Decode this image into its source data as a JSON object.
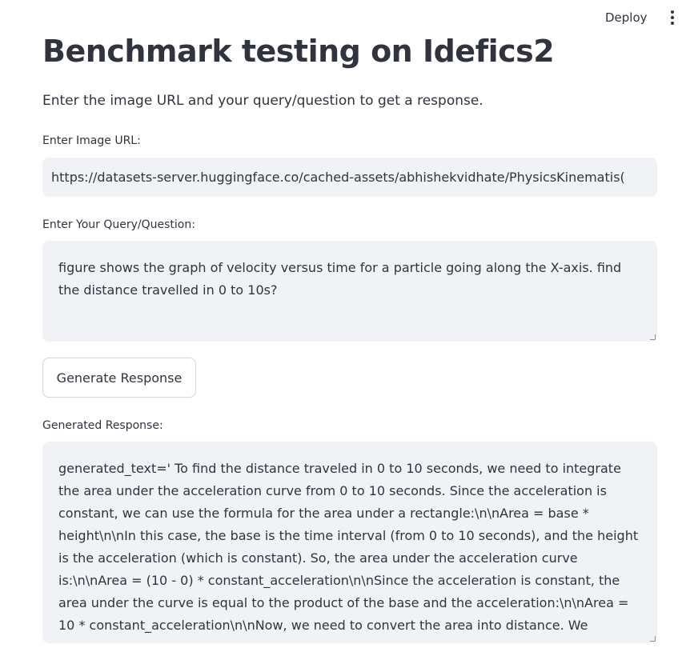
{
  "header": {
    "deploy_label": "Deploy",
    "menu_icon": "vertical-dots-icon"
  },
  "main": {
    "title": "Benchmark testing on Idefics2",
    "subtitle": "Enter the image URL and your query/question to get a response.",
    "image_url": {
      "label": "Enter Image URL:",
      "value": "https://datasets-server.huggingface.co/cached-assets/abhishekvidhate/PhysicsKinematis("
    },
    "query": {
      "label": "Enter Your Query/Question:",
      "value": "figure shows the graph of velocity versus time for a particle going along the X-axis. find the distance travelled in 0 to 10s?"
    },
    "generate_button_label": "Generate Response",
    "response": {
      "label": "Generated Response:",
      "value": "generated_text=' To find the distance traveled in 0 to 10 seconds, we need to integrate the area under the acceleration curve from 0 to 10 seconds. Since the acceleration is constant, we can use the formula for the area under a rectangle:\\n\\nArea = base * height\\n\\nIn this case, the base is the time interval (from 0 to 10 seconds), and the height is the acceleration (which is constant). So, the area under the acceleration curve is:\\n\\nArea = (10 - 0) * constant_acceleration\\n\\nSince the acceleration is constant, the area under the curve is equal to the product of the base and the acceleration:\\n\\nArea = 10 * constant_acceleration\\n\\nNow, we need to convert the area into distance. We"
    }
  },
  "colors": {
    "text": "#31333f",
    "input_bg": "#f0f2f6",
    "button_border": "#d5d6db"
  }
}
